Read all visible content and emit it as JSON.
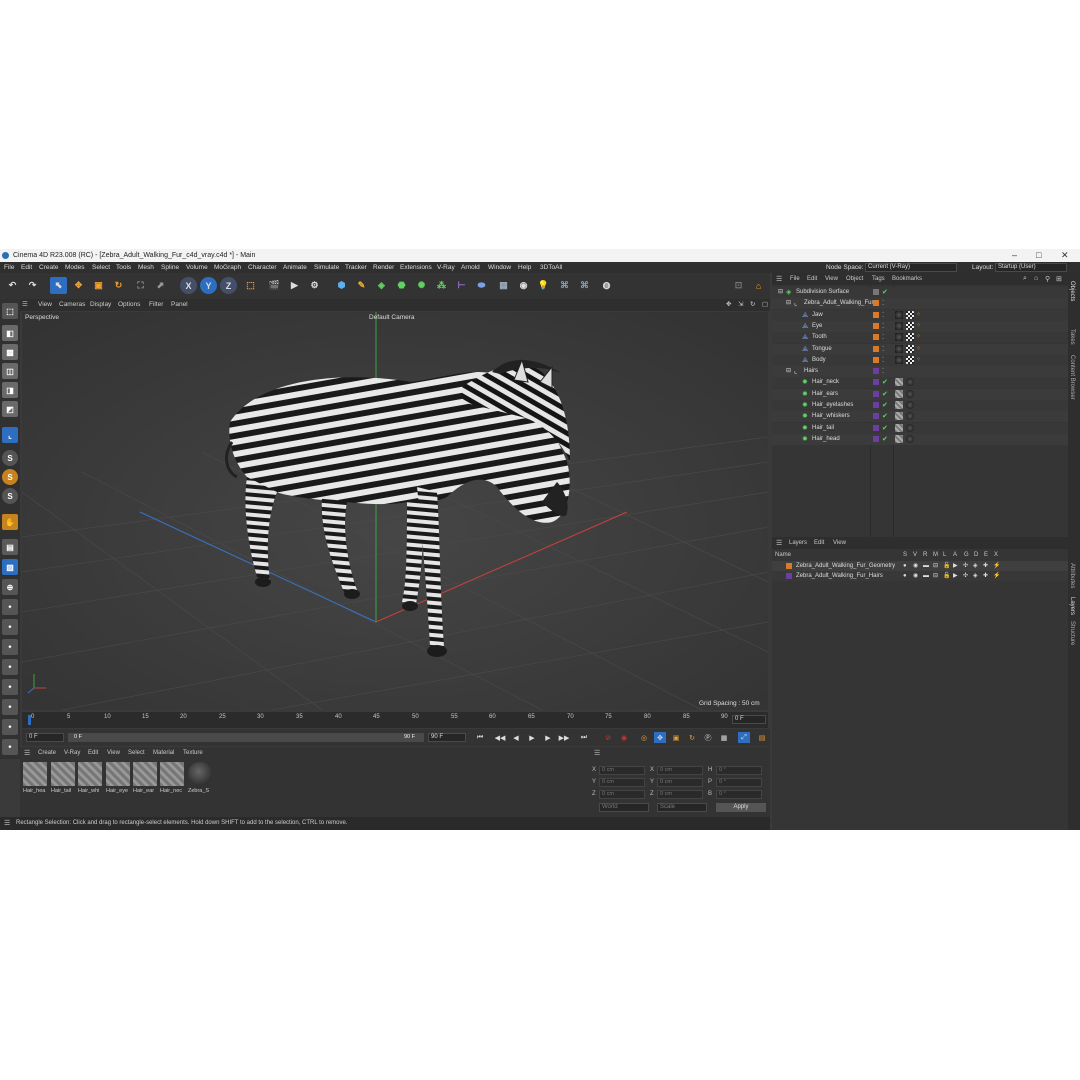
{
  "window": {
    "title": "Cinema 4D R23.008 (RC) - [Zebra_Adult_Walking_Fur_c4d_vray.c4d *] - Main",
    "minimize": "–",
    "maximize": "□",
    "close": "✕"
  },
  "menu": [
    "File",
    "Edit",
    "Create",
    "Modes",
    "Select",
    "Tools",
    "Mesh",
    "Spline",
    "Volume",
    "MoGraph",
    "Character",
    "Animate",
    "Simulate",
    "Tracker",
    "Render",
    "Extensions",
    "V-Ray",
    "Arnold",
    "Window",
    "Help",
    "3DToAll"
  ],
  "node_space": {
    "label": "Node Space:",
    "value": "Current (V-Ray)"
  },
  "layout": {
    "label": "Layout:",
    "value": "Startup (User)"
  },
  "toolbar": {
    "axis_x": "X",
    "axis_y": "Y",
    "axis_z": "Z"
  },
  "viewport": {
    "menu": [
      "View",
      "Cameras",
      "Display",
      "Options",
      "Filter",
      "Panel"
    ],
    "view_name": "Perspective",
    "camera": "Default Camera",
    "grid_spacing": "Grid Spacing : 50 cm"
  },
  "timeline": {
    "ticks": [
      "0",
      "5",
      "10",
      "15",
      "20",
      "25",
      "30",
      "35",
      "40",
      "45",
      "50",
      "55",
      "60",
      "65",
      "70",
      "75",
      "80",
      "85",
      "90"
    ],
    "current_frame": "0 F"
  },
  "transport": {
    "start": "0 F",
    "range_start": "0 F",
    "range_end": "90 F",
    "end": "90 F"
  },
  "materials": {
    "menu": [
      "Create",
      "V-Ray",
      "Edit",
      "View",
      "Select",
      "Material",
      "Texture"
    ],
    "items": [
      "Hair_hea",
      "Hair_tail",
      "Hair_whi",
      "Hair_eye",
      "Hair_ear",
      "Hair_nec",
      "Zebra_S"
    ]
  },
  "coords": {
    "rows": [
      {
        "a": "X",
        "av": "0 cm",
        "b": "X",
        "bv": "0 cm",
        "c": "H",
        "cv": "0 °"
      },
      {
        "a": "Y",
        "av": "0 cm",
        "b": "Y",
        "bv": "0 cm",
        "c": "P",
        "cv": "0 °"
      },
      {
        "a": "Z",
        "av": "0 cm",
        "b": "Z",
        "bv": "0 cm",
        "c": "B",
        "cv": "0 °"
      }
    ],
    "world": "World",
    "scale": "Scale",
    "apply": "Apply"
  },
  "status": "Rectangle Selection: Click and drag to rectangle-select elements. Hold down SHIFT to add to the selection, CTRL to remove.",
  "objects": {
    "menu": [
      "File",
      "Edit",
      "View",
      "Object",
      "Tags",
      "Bookmarks"
    ],
    "tree": [
      {
        "name": "Subdivision Surface",
        "indent": 0,
        "kind": "subdiv"
      },
      {
        "name": "Zebra_Adult_Walking_Fur",
        "indent": 1,
        "kind": "null"
      },
      {
        "name": "Jaw",
        "indent": 2,
        "kind": "mesh"
      },
      {
        "name": "Eye",
        "indent": 2,
        "kind": "mesh"
      },
      {
        "name": "Tooth",
        "indent": 2,
        "kind": "mesh"
      },
      {
        "name": "Tongue",
        "indent": 2,
        "kind": "mesh"
      },
      {
        "name": "Body",
        "indent": 2,
        "kind": "mesh"
      },
      {
        "name": "Hairs",
        "indent": 1,
        "kind": "null"
      },
      {
        "name": "Hair_neck",
        "indent": 2,
        "kind": "hair"
      },
      {
        "name": "Hair_ears",
        "indent": 2,
        "kind": "hair"
      },
      {
        "name": "Hair_eyelashes",
        "indent": 2,
        "kind": "hair"
      },
      {
        "name": "Hair_whiskers",
        "indent": 2,
        "kind": "hair"
      },
      {
        "name": "Hair_tail",
        "indent": 2,
        "kind": "hair"
      },
      {
        "name": "Hair_head",
        "indent": 2,
        "kind": "hair"
      }
    ]
  },
  "layers": {
    "menu": [
      "Layers",
      "Edit",
      "View"
    ],
    "header_name": "Name",
    "header_cols": [
      "S",
      "V",
      "R",
      "M",
      "L",
      "A",
      "G",
      "D",
      "E",
      "X"
    ],
    "items": [
      {
        "name": "Zebra_Adult_Walking_Fur_Geometry",
        "color": "#d87a2a"
      },
      {
        "name": "Zebra_Adult_Walking_Fur_Hairs",
        "color": "#6a3fa0"
      }
    ]
  },
  "side_tabs": [
    "Objects",
    "Takes",
    "Content Browser",
    "Attributes",
    "Layers",
    "Structure"
  ],
  "colors": {
    "accent": "#2d6ec0",
    "orange_tag": "#d87a2a",
    "purple_tag": "#6a3fa0",
    "green_check": "#5fd35f"
  }
}
